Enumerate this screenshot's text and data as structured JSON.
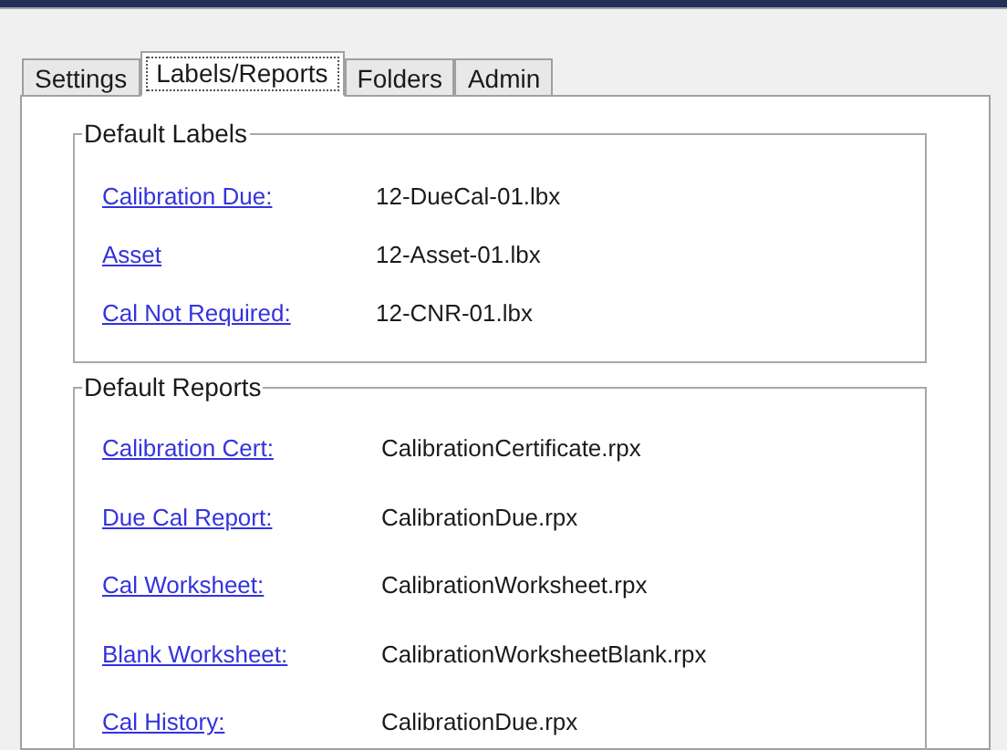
{
  "tabs": [
    {
      "label": "Settings",
      "selected": false
    },
    {
      "label": "Labels/Reports",
      "selected": true
    },
    {
      "label": "Folders",
      "selected": false
    },
    {
      "label": "Admin",
      "selected": false
    }
  ],
  "groups": [
    {
      "title": "Default Labels",
      "rows": [
        {
          "label": "Calibration Due:",
          "value": "12-DueCal-01.lbx"
        },
        {
          "label": "Asset",
          "value": "12-Asset-01.lbx"
        },
        {
          "label": "Cal Not Required:",
          "value": "12-CNR-01.lbx"
        }
      ]
    },
    {
      "title": "Default Reports",
      "rows": [
        {
          "label": "Calibration Cert:",
          "value": "CalibrationCertificate.rpx"
        },
        {
          "label": "Due Cal Report:",
          "value": "CalibrationDue.rpx"
        },
        {
          "label": "Cal Worksheet:",
          "value": "CalibrationWorksheet.rpx"
        },
        {
          "label": "Blank Worksheet:",
          "value": "CalibrationWorksheetBlank.rpx"
        },
        {
          "label": "Cal History:",
          "value": "CalibrationDue.rpx"
        }
      ]
    }
  ]
}
